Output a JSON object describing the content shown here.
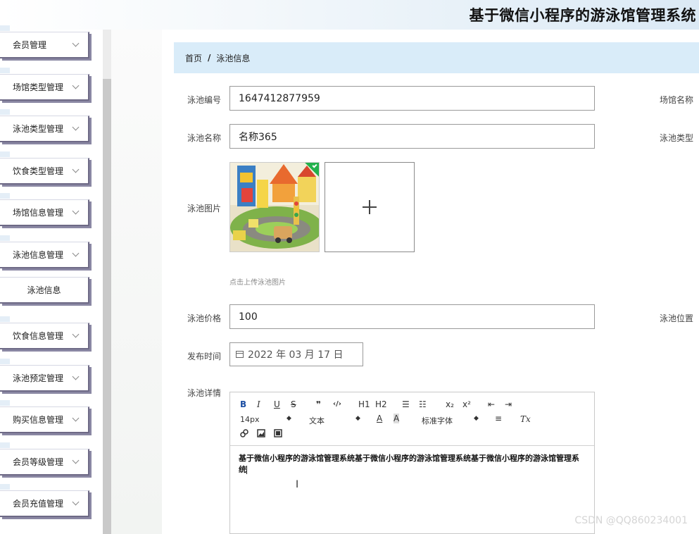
{
  "app": {
    "title": "基于微信小程序的游泳馆管理系统"
  },
  "sidebar": {
    "groups": [
      {
        "label": "会员管理"
      },
      {
        "label": "场馆类型管理"
      },
      {
        "label": "泳池类型管理"
      },
      {
        "label": "饮食类型管理"
      },
      {
        "label": "场馆信息管理"
      },
      {
        "label": "泳池信息管理"
      },
      {
        "label": "饮食信息管理"
      },
      {
        "label": "泳池预定管理"
      },
      {
        "label": "购买信息管理"
      },
      {
        "label": "会员等级管理"
      },
      {
        "label": "会员充值管理"
      }
    ],
    "sub_item": "泳池信息"
  },
  "breadcrumb": {
    "home": "首页",
    "separator": "/",
    "current": "泳池信息"
  },
  "form": {
    "pool_id": {
      "label": "泳池编号",
      "value": "1647412877959"
    },
    "pool_name": {
      "label": "泳池名称",
      "value": "名称365"
    },
    "pool_image": {
      "label": "泳池图片",
      "hint": "点击上传泳池图片"
    },
    "pool_price": {
      "label": "泳池价格",
      "value": "100"
    },
    "publish_time": {
      "label": "发布时间",
      "value": "2022 年 03 月 17 日"
    },
    "pool_detail": {
      "label": "泳池详情"
    },
    "right_labels": {
      "venue_name": "场馆名称",
      "pool_type": "泳池类型",
      "pool_location": "泳池位置"
    }
  },
  "editor": {
    "toolbar": {
      "bold": "B",
      "italic": "I",
      "underline": "U",
      "strike": "S",
      "quote": "❞",
      "code": "‹/›",
      "h1": "H1",
      "h2": "H2",
      "ordered_list": "☰",
      "bullet_list": "☷",
      "subscript": "x₂",
      "superscript": "x²",
      "outdent": "⇤",
      "indent": "⇥",
      "font_size": "14px",
      "text_style": "文本",
      "font_color": "A",
      "bg_color": "A",
      "font_family": "标准字体",
      "align": "≡",
      "clear_format": "Tx"
    },
    "content": "基于微信小程序的游泳馆管理系统基于微信小程序的游泳馆管理系统基于微信小程序的游泳馆管理系统"
  },
  "watermark": "CSDN @QQ860234001"
}
